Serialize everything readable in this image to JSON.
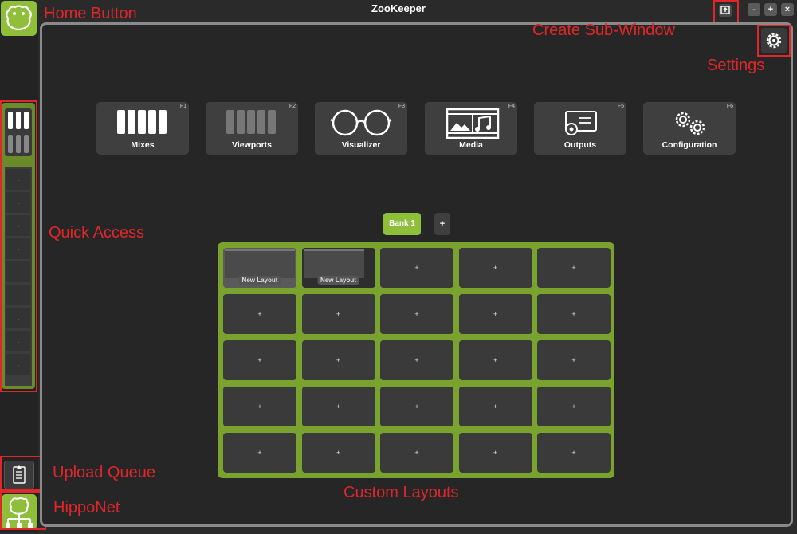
{
  "window": {
    "title": "ZooKeeper",
    "controls": [
      "-",
      "+",
      "×"
    ]
  },
  "apps": [
    {
      "label": "Mixes",
      "key": "F1",
      "icon": "mixes-icon"
    },
    {
      "label": "Viewports",
      "key": "F2",
      "icon": "viewports-icon"
    },
    {
      "label": "Visualizer",
      "key": "F3",
      "icon": "visualizer-icon"
    },
    {
      "label": "Media",
      "key": "F4",
      "icon": "media-icon"
    },
    {
      "label": "Outputs",
      "key": "F5",
      "icon": "outputs-icon"
    },
    {
      "label": "Configuration",
      "key": "F6",
      "icon": "configuration-icon"
    }
  ],
  "bank": {
    "label": "Bank 1",
    "add": "+"
  },
  "layouts": {
    "cells": [
      {
        "type": "layout",
        "name": "New Layout"
      },
      {
        "type": "layout",
        "name": "New Layout"
      },
      {
        "type": "empty",
        "symbol": "+"
      },
      {
        "type": "empty",
        "symbol": "+"
      },
      {
        "type": "empty",
        "symbol": "+"
      },
      {
        "type": "empty",
        "symbol": "+"
      },
      {
        "type": "empty",
        "symbol": "+"
      },
      {
        "type": "empty",
        "symbol": "+"
      },
      {
        "type": "empty",
        "symbol": "+"
      },
      {
        "type": "empty",
        "symbol": "+"
      },
      {
        "type": "empty",
        "symbol": "+"
      },
      {
        "type": "empty",
        "symbol": "+"
      },
      {
        "type": "empty",
        "symbol": "+"
      },
      {
        "type": "empty",
        "symbol": "+"
      },
      {
        "type": "empty",
        "symbol": "+"
      },
      {
        "type": "empty",
        "symbol": "+"
      },
      {
        "type": "empty",
        "symbol": "+"
      },
      {
        "type": "empty",
        "symbol": "+"
      },
      {
        "type": "empty",
        "symbol": "+"
      },
      {
        "type": "empty",
        "symbol": "+"
      },
      {
        "type": "empty",
        "symbol": "+"
      },
      {
        "type": "empty",
        "symbol": "+"
      },
      {
        "type": "empty",
        "symbol": "+"
      },
      {
        "type": "empty",
        "symbol": "+"
      },
      {
        "type": "empty",
        "symbol": "+"
      }
    ]
  },
  "quick_access": {
    "slots": [
      ".",
      ".",
      ".",
      ".",
      ".",
      ".",
      ".",
      ".",
      ".",
      "."
    ]
  },
  "annotations": {
    "home_button": "Home Button",
    "create_sub_window": "Create Sub-Window",
    "settings": "Settings",
    "quick_access": "Quick Access",
    "upload_queue": "Upload Queue",
    "hipponet": "HippoNet",
    "custom_layouts": "Custom Layouts"
  },
  "colors": {
    "accent_green": "#8fbf3a",
    "grid_green": "#7aa22e",
    "annotation_red": "#e0262a",
    "panel_bg": "#262626"
  }
}
